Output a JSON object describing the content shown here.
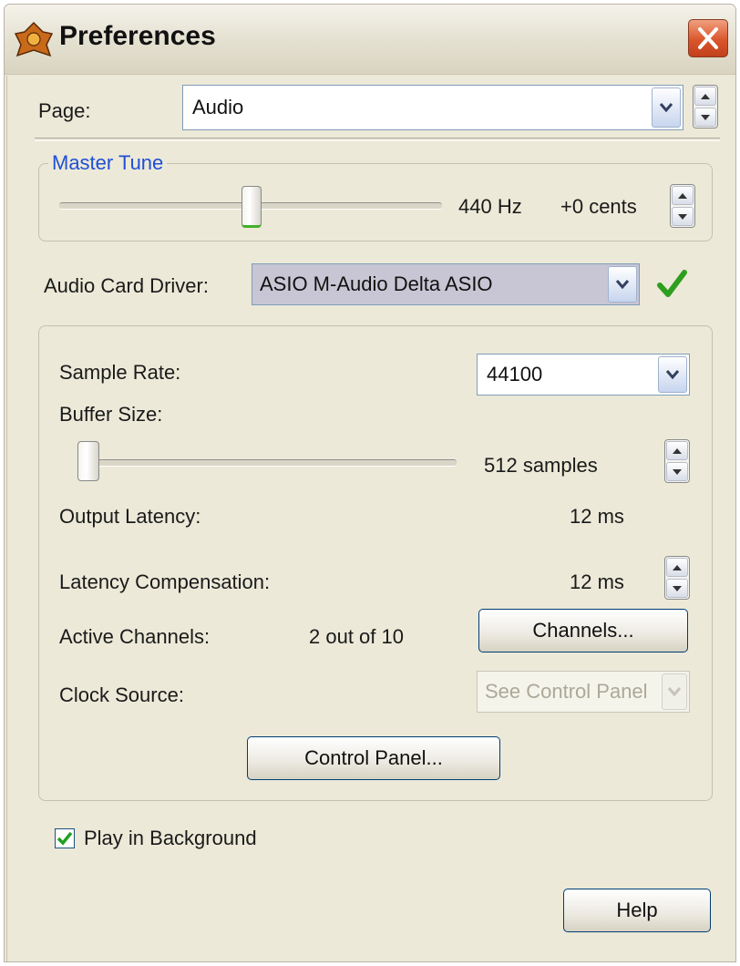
{
  "window": {
    "title": "Preferences",
    "app_icon": "reason-app-icon",
    "close_icon": "close-icon"
  },
  "page_selector": {
    "label": "Page:",
    "value": "Audio"
  },
  "master_tune": {
    "legend": "Master Tune",
    "frequency": "440 Hz",
    "cents": "+0 cents",
    "cents_value": 0
  },
  "audio_driver": {
    "label": "Audio Card Driver:",
    "value": "ASIO M-Audio Delta ASIO",
    "status_icon": "checkmark-icon",
    "status_color": "#2e9e1e"
  },
  "settings": {
    "sample_rate": {
      "label": "Sample Rate:",
      "value": "44100"
    },
    "buffer_size": {
      "label": "Buffer Size:",
      "value": "512 samples"
    },
    "output_latency": {
      "label": "Output Latency:",
      "value": "12 ms"
    },
    "latency_compensation": {
      "label": "Latency Compensation:",
      "value": "12 ms"
    },
    "active_channels": {
      "label": "Active Channels:",
      "value": "2 out of 10",
      "button": "Channels..."
    },
    "clock_source": {
      "label": "Clock Source:",
      "value": "See Control Panel",
      "enabled": false
    },
    "control_panel_button": "Control Panel..."
  },
  "play_in_background": {
    "label": "Play in Background",
    "checked": true
  },
  "help_button": "Help",
  "colors": {
    "window_bg": "#ece9d8",
    "accent_blue": "#1f4fd6",
    "check_green": "#2e9e1e"
  }
}
